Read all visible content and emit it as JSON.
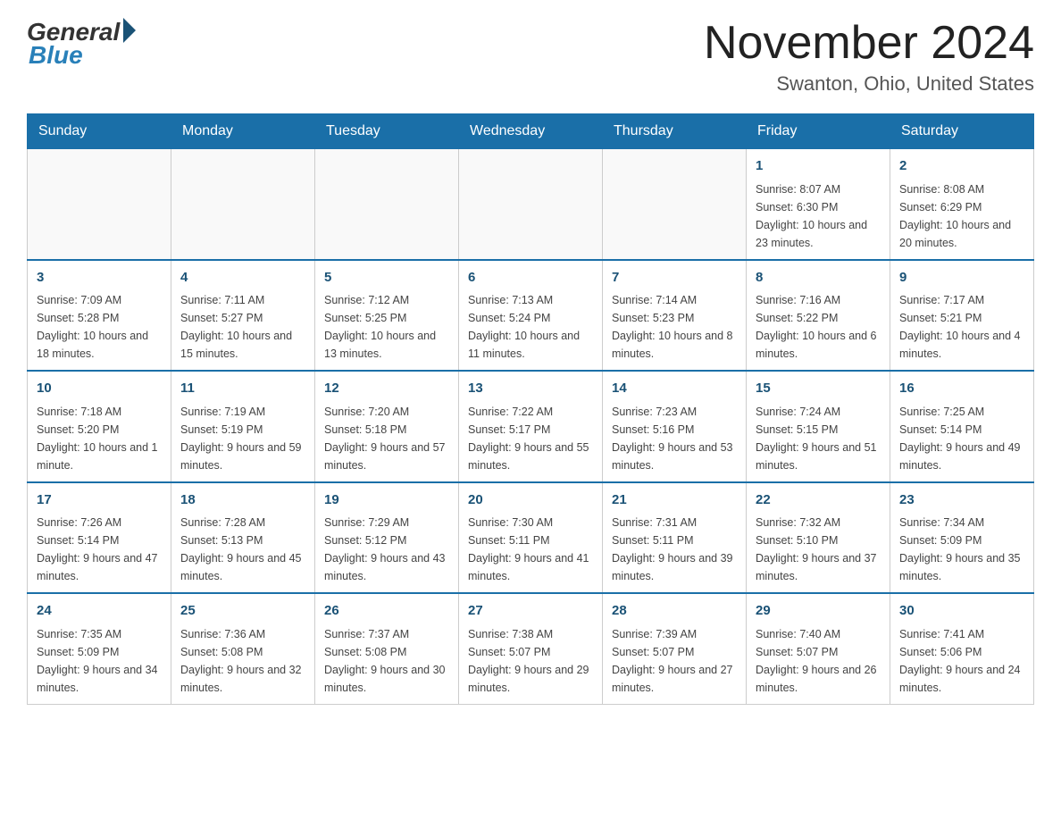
{
  "logo": {
    "general": "General",
    "blue": "Blue"
  },
  "header": {
    "month_title": "November 2024",
    "location": "Swanton, Ohio, United States"
  },
  "weekdays": [
    "Sunday",
    "Monday",
    "Tuesday",
    "Wednesday",
    "Thursday",
    "Friday",
    "Saturday"
  ],
  "weeks": [
    [
      {
        "day": "",
        "sunrise": "",
        "sunset": "",
        "daylight": ""
      },
      {
        "day": "",
        "sunrise": "",
        "sunset": "",
        "daylight": ""
      },
      {
        "day": "",
        "sunrise": "",
        "sunset": "",
        "daylight": ""
      },
      {
        "day": "",
        "sunrise": "",
        "sunset": "",
        "daylight": ""
      },
      {
        "day": "",
        "sunrise": "",
        "sunset": "",
        "daylight": ""
      },
      {
        "day": "1",
        "sunrise": "Sunrise: 8:07 AM",
        "sunset": "Sunset: 6:30 PM",
        "daylight": "Daylight: 10 hours and 23 minutes."
      },
      {
        "day": "2",
        "sunrise": "Sunrise: 8:08 AM",
        "sunset": "Sunset: 6:29 PM",
        "daylight": "Daylight: 10 hours and 20 minutes."
      }
    ],
    [
      {
        "day": "3",
        "sunrise": "Sunrise: 7:09 AM",
        "sunset": "Sunset: 5:28 PM",
        "daylight": "Daylight: 10 hours and 18 minutes."
      },
      {
        "day": "4",
        "sunrise": "Sunrise: 7:11 AM",
        "sunset": "Sunset: 5:27 PM",
        "daylight": "Daylight: 10 hours and 15 minutes."
      },
      {
        "day": "5",
        "sunrise": "Sunrise: 7:12 AM",
        "sunset": "Sunset: 5:25 PM",
        "daylight": "Daylight: 10 hours and 13 minutes."
      },
      {
        "day": "6",
        "sunrise": "Sunrise: 7:13 AM",
        "sunset": "Sunset: 5:24 PM",
        "daylight": "Daylight: 10 hours and 11 minutes."
      },
      {
        "day": "7",
        "sunrise": "Sunrise: 7:14 AM",
        "sunset": "Sunset: 5:23 PM",
        "daylight": "Daylight: 10 hours and 8 minutes."
      },
      {
        "day": "8",
        "sunrise": "Sunrise: 7:16 AM",
        "sunset": "Sunset: 5:22 PM",
        "daylight": "Daylight: 10 hours and 6 minutes."
      },
      {
        "day": "9",
        "sunrise": "Sunrise: 7:17 AM",
        "sunset": "Sunset: 5:21 PM",
        "daylight": "Daylight: 10 hours and 4 minutes."
      }
    ],
    [
      {
        "day": "10",
        "sunrise": "Sunrise: 7:18 AM",
        "sunset": "Sunset: 5:20 PM",
        "daylight": "Daylight: 10 hours and 1 minute."
      },
      {
        "day": "11",
        "sunrise": "Sunrise: 7:19 AM",
        "sunset": "Sunset: 5:19 PM",
        "daylight": "Daylight: 9 hours and 59 minutes."
      },
      {
        "day": "12",
        "sunrise": "Sunrise: 7:20 AM",
        "sunset": "Sunset: 5:18 PM",
        "daylight": "Daylight: 9 hours and 57 minutes."
      },
      {
        "day": "13",
        "sunrise": "Sunrise: 7:22 AM",
        "sunset": "Sunset: 5:17 PM",
        "daylight": "Daylight: 9 hours and 55 minutes."
      },
      {
        "day": "14",
        "sunrise": "Sunrise: 7:23 AM",
        "sunset": "Sunset: 5:16 PM",
        "daylight": "Daylight: 9 hours and 53 minutes."
      },
      {
        "day": "15",
        "sunrise": "Sunrise: 7:24 AM",
        "sunset": "Sunset: 5:15 PM",
        "daylight": "Daylight: 9 hours and 51 minutes."
      },
      {
        "day": "16",
        "sunrise": "Sunrise: 7:25 AM",
        "sunset": "Sunset: 5:14 PM",
        "daylight": "Daylight: 9 hours and 49 minutes."
      }
    ],
    [
      {
        "day": "17",
        "sunrise": "Sunrise: 7:26 AM",
        "sunset": "Sunset: 5:14 PM",
        "daylight": "Daylight: 9 hours and 47 minutes."
      },
      {
        "day": "18",
        "sunrise": "Sunrise: 7:28 AM",
        "sunset": "Sunset: 5:13 PM",
        "daylight": "Daylight: 9 hours and 45 minutes."
      },
      {
        "day": "19",
        "sunrise": "Sunrise: 7:29 AM",
        "sunset": "Sunset: 5:12 PM",
        "daylight": "Daylight: 9 hours and 43 minutes."
      },
      {
        "day": "20",
        "sunrise": "Sunrise: 7:30 AM",
        "sunset": "Sunset: 5:11 PM",
        "daylight": "Daylight: 9 hours and 41 minutes."
      },
      {
        "day": "21",
        "sunrise": "Sunrise: 7:31 AM",
        "sunset": "Sunset: 5:11 PM",
        "daylight": "Daylight: 9 hours and 39 minutes."
      },
      {
        "day": "22",
        "sunrise": "Sunrise: 7:32 AM",
        "sunset": "Sunset: 5:10 PM",
        "daylight": "Daylight: 9 hours and 37 minutes."
      },
      {
        "day": "23",
        "sunrise": "Sunrise: 7:34 AM",
        "sunset": "Sunset: 5:09 PM",
        "daylight": "Daylight: 9 hours and 35 minutes."
      }
    ],
    [
      {
        "day": "24",
        "sunrise": "Sunrise: 7:35 AM",
        "sunset": "Sunset: 5:09 PM",
        "daylight": "Daylight: 9 hours and 34 minutes."
      },
      {
        "day": "25",
        "sunrise": "Sunrise: 7:36 AM",
        "sunset": "Sunset: 5:08 PM",
        "daylight": "Daylight: 9 hours and 32 minutes."
      },
      {
        "day": "26",
        "sunrise": "Sunrise: 7:37 AM",
        "sunset": "Sunset: 5:08 PM",
        "daylight": "Daylight: 9 hours and 30 minutes."
      },
      {
        "day": "27",
        "sunrise": "Sunrise: 7:38 AM",
        "sunset": "Sunset: 5:07 PM",
        "daylight": "Daylight: 9 hours and 29 minutes."
      },
      {
        "day": "28",
        "sunrise": "Sunrise: 7:39 AM",
        "sunset": "Sunset: 5:07 PM",
        "daylight": "Daylight: 9 hours and 27 minutes."
      },
      {
        "day": "29",
        "sunrise": "Sunrise: 7:40 AM",
        "sunset": "Sunset: 5:07 PM",
        "daylight": "Daylight: 9 hours and 26 minutes."
      },
      {
        "day": "30",
        "sunrise": "Sunrise: 7:41 AM",
        "sunset": "Sunset: 5:06 PM",
        "daylight": "Daylight: 9 hours and 24 minutes."
      }
    ]
  ]
}
